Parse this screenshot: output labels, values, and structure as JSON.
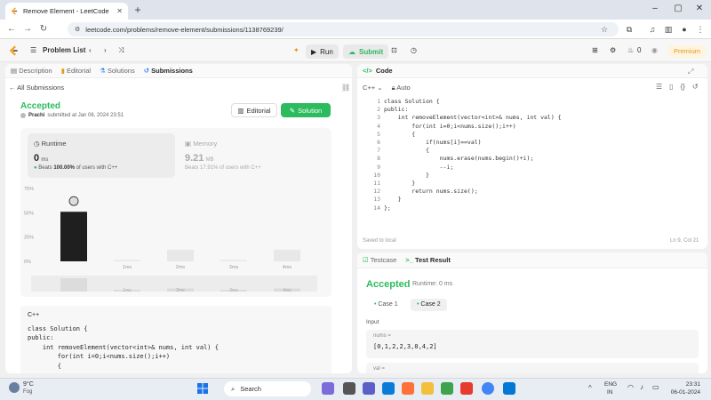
{
  "browser": {
    "tab_title": "Remove Element - LeetCode",
    "url": "leetcode.com/problems/remove-element/submissions/1138769239/"
  },
  "topbar": {
    "problem_list": "Problem List",
    "run": "Run",
    "submit": "Submit",
    "fire_count": "0",
    "premium": "Premium"
  },
  "left_tabs": [
    "Description",
    "Editorial",
    "Solutions",
    "Submissions"
  ],
  "submission": {
    "all_submissions": "All Submissions",
    "status": "Accepted",
    "user": "Prachi",
    "submitted_text": "submitted at Jan 06, 2024 23:51",
    "editorial_btn": "Editorial",
    "solution_btn": "Solution",
    "runtime_label": "Runtime",
    "runtime_value": "0",
    "runtime_unit": "ms",
    "runtime_beats_prefix": "Beats",
    "runtime_beats_pct": "100.00%",
    "runtime_beats_suffix": "of users with C++",
    "memory_label": "Memory",
    "memory_value": "9.21",
    "memory_unit": "MB",
    "memory_beats": "Beats 17.91% of users with C++"
  },
  "chart_data": {
    "type": "bar",
    "categories": [
      "0ms",
      "1ms",
      "2ms",
      "3ms",
      "4ms"
    ],
    "x_tick_labels": [
      "",
      "1ms",
      "2ms",
      "3ms",
      "4ms"
    ],
    "values": [
      51,
      1.5,
      12,
      1.5,
      12
    ],
    "yticks": [
      "75%",
      "50%",
      "25%",
      "0%"
    ],
    "ylim": [
      0,
      75
    ],
    "highlight_index": 0,
    "highlight_color": "#1f1f1f",
    "bar_color": "#e8e8e8"
  },
  "code_preview": {
    "lang": "C++",
    "lines": [
      "class Solution {",
      "public:",
      "    int removeElement(vector<int>& nums, int val) {",
      "        for(int i=0;i<nums.size();i++)",
      "        {"
    ]
  },
  "code_panel": {
    "title": "Code",
    "lang": "C++",
    "mode": "Auto",
    "lines": [
      "class Solution {",
      "public:",
      "    int removeElement(vector<int>& nums, int val) {",
      "        for(int i=0;i<nums.size();i++)",
      "        {",
      "            if(nums[i]==val)",
      "            {",
      "                nums.erase(nums.begin()+i);",
      "                --i;",
      "            }",
      "        }",
      "        return nums.size();",
      "    }",
      "};"
    ],
    "saved": "Saved to local",
    "cursor": "Ln 9, Col 21"
  },
  "test_panel": {
    "testcase_tab": "Testcase",
    "result_tab": "Test Result",
    "status": "Accepted",
    "runtime": "Runtime: 0 ms",
    "cases": [
      "Case 1",
      "Case 2"
    ],
    "input_label": "Input",
    "nums_label": "nums =",
    "nums_value": "[0,1,2,2,3,0,4,2]",
    "val_label": "val ="
  },
  "taskbar": {
    "weather_temp": "9°C",
    "weather_desc": "Fog",
    "search": "Search",
    "lang1": "ENG",
    "lang2": "IN",
    "time": "23:31",
    "date": "06-01-2024"
  },
  "colors": {
    "accent_green": "#2cbb5d",
    "premium_orange": "#e49a1a"
  }
}
